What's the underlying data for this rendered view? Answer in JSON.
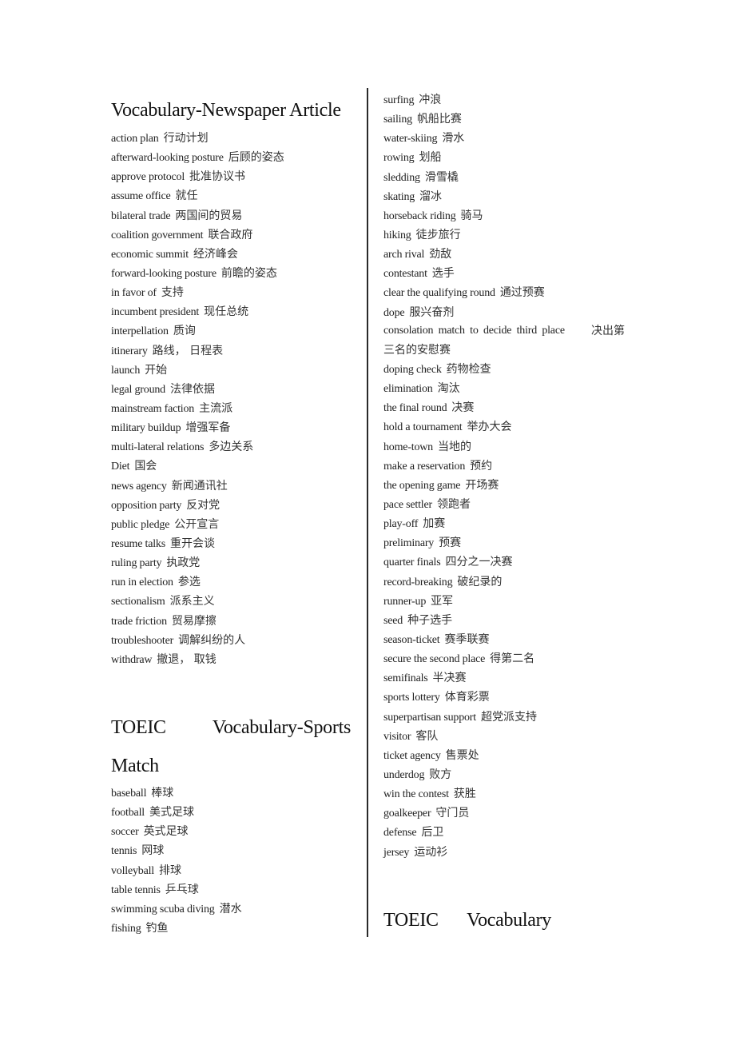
{
  "left_column": {
    "section1": {
      "heading": "Vocabulary-Newspaper Article",
      "entries": [
        {
          "en": "action plan",
          "zh": "行动计划"
        },
        {
          "en": "afterward-looking posture",
          "zh": "后顾的姿态"
        },
        {
          "en": "approve protocol",
          "zh": "批准协议书"
        },
        {
          "en": "assume office",
          "zh": "就任"
        },
        {
          "en": "bilateral trade",
          "zh": "两国间的贸易"
        },
        {
          "en": "coalition government",
          "zh": "联合政府"
        },
        {
          "en": "economic summit",
          "zh": "经济峰会"
        },
        {
          "en": "forward-looking posture",
          "zh": "前瞻的姿态"
        },
        {
          "en": "in favor of",
          "zh": "支持"
        },
        {
          "en": "incumbent president",
          "zh": "现任总统"
        },
        {
          "en": "interpellation",
          "zh": "质询"
        },
        {
          "en": "itinerary",
          "zh": "路线，  日程表"
        },
        {
          "en": "launch",
          "zh": "开始"
        },
        {
          "en": "legal ground",
          "zh": "法律依据"
        },
        {
          "en": "mainstream faction",
          "zh": "主流派"
        },
        {
          "en": "military buildup",
          "zh": "增强军备"
        },
        {
          "en": "multi-lateral relations",
          "zh": "多边关系"
        },
        {
          "en": "Diet",
          "zh": "国会"
        },
        {
          "en": "news agency",
          "zh": "新闻通讯社"
        },
        {
          "en": "opposition party",
          "zh": "反对党"
        },
        {
          "en": "public pledge",
          "zh": "公开宣言"
        },
        {
          "en": "resume talks",
          "zh": "重开会谈"
        },
        {
          "en": "ruling party",
          "zh": "执政党"
        },
        {
          "en": "run in election",
          "zh": "参选"
        },
        {
          "en": "sectionalism",
          "zh": "派系主义"
        },
        {
          "en": "trade friction",
          "zh": "贸易摩擦"
        },
        {
          "en": "troubleshooter",
          "zh": "调解纠纷的人"
        },
        {
          "en": "withdraw",
          "zh": "撤退，  取钱"
        }
      ]
    },
    "section2": {
      "heading_word1": "TOEIC",
      "heading_word2": "Vocabulary-Sports",
      "heading_line2": "Match",
      "entries": [
        {
          "en": "baseball",
          "zh": "棒球"
        },
        {
          "en": "football",
          "zh": "美式足球"
        },
        {
          "en": "soccer",
          "zh": "英式足球"
        },
        {
          "en": "tennis",
          "zh": "网球"
        },
        {
          "en": "volleyball",
          "zh": "排球"
        },
        {
          "en": "table tennis",
          "zh": "乒乓球"
        },
        {
          "en": "swimming scuba diving",
          "zh": "潜水"
        },
        {
          "en": "fishing",
          "zh": "钓鱼"
        }
      ]
    }
  },
  "right_column": {
    "entries_a": [
      {
        "en": "surfing",
        "zh": "冲浪"
      },
      {
        "en": "sailing",
        "zh": "帆船比赛"
      },
      {
        "en": "water-skiing",
        "zh": "滑水"
      },
      {
        "en": "rowing",
        "zh": "划船"
      },
      {
        "en": "sledding",
        "zh": "滑雪橇"
      },
      {
        "en": "skating",
        "zh": "溜冰"
      },
      {
        "en": "horseback riding",
        "zh": "骑马"
      },
      {
        "en": "hiking",
        "zh": "徒步旅行"
      },
      {
        "en": "arch rival",
        "zh": "劲敌"
      },
      {
        "en": "contestant",
        "zh": "选手"
      },
      {
        "en": "clear the qualifying round",
        "zh": "通过预赛"
      },
      {
        "en": "dope",
        "zh": "服兴奋剂"
      }
    ],
    "consolation": {
      "en": "consolation match to decide third place",
      "zh_line1": "决出第",
      "zh_line2": "三名的安慰赛"
    },
    "entries_b": [
      {
        "en": "doping check",
        "zh": "药物检查"
      },
      {
        "en": "elimination",
        "zh": "淘汰"
      },
      {
        "en": "the final round",
        "zh": "决赛"
      },
      {
        "en": "hold a tournament",
        "zh": "举办大会"
      },
      {
        "en": "home-town",
        "zh": "当地的"
      },
      {
        "en": "make a reservation",
        "zh": "预约"
      },
      {
        "en": "the opening game",
        "zh": "开场赛"
      },
      {
        "en": "pace settler",
        "zh": "领跑者"
      },
      {
        "en": "play-off",
        "zh": "加赛"
      },
      {
        "en": "preliminary",
        "zh": "预赛"
      },
      {
        "en": "quarter finals",
        "zh": "四分之一决赛"
      },
      {
        "en": "record-breaking",
        "zh": "破纪录的"
      },
      {
        "en": "runner-up",
        "zh": "亚军"
      },
      {
        "en": "seed",
        "zh": "种子选手"
      },
      {
        "en": "season-ticket",
        "zh": "赛季联赛"
      },
      {
        "en": "secure the second place",
        "zh": "得第二名"
      },
      {
        "en": "semifinals",
        "zh": "半决赛"
      },
      {
        "en": "sports lottery",
        "zh": "体育彩票"
      },
      {
        "en": "superpartisan support",
        "zh": "超党派支持"
      },
      {
        "en": "visitor",
        "zh": "客队"
      },
      {
        "en": "ticket agency",
        "zh": "售票处"
      },
      {
        "en": "underdog",
        "zh": "败方"
      },
      {
        "en": "win the contest",
        "zh": "获胜"
      },
      {
        "en": "goalkeeper",
        "zh": "守门员"
      },
      {
        "en": "defense",
        "zh": "后卫"
      },
      {
        "en": "jersey",
        "zh": "运动衫"
      }
    ],
    "section3": {
      "heading_word1": "TOEIC",
      "heading_word2": "Vocabulary"
    }
  }
}
